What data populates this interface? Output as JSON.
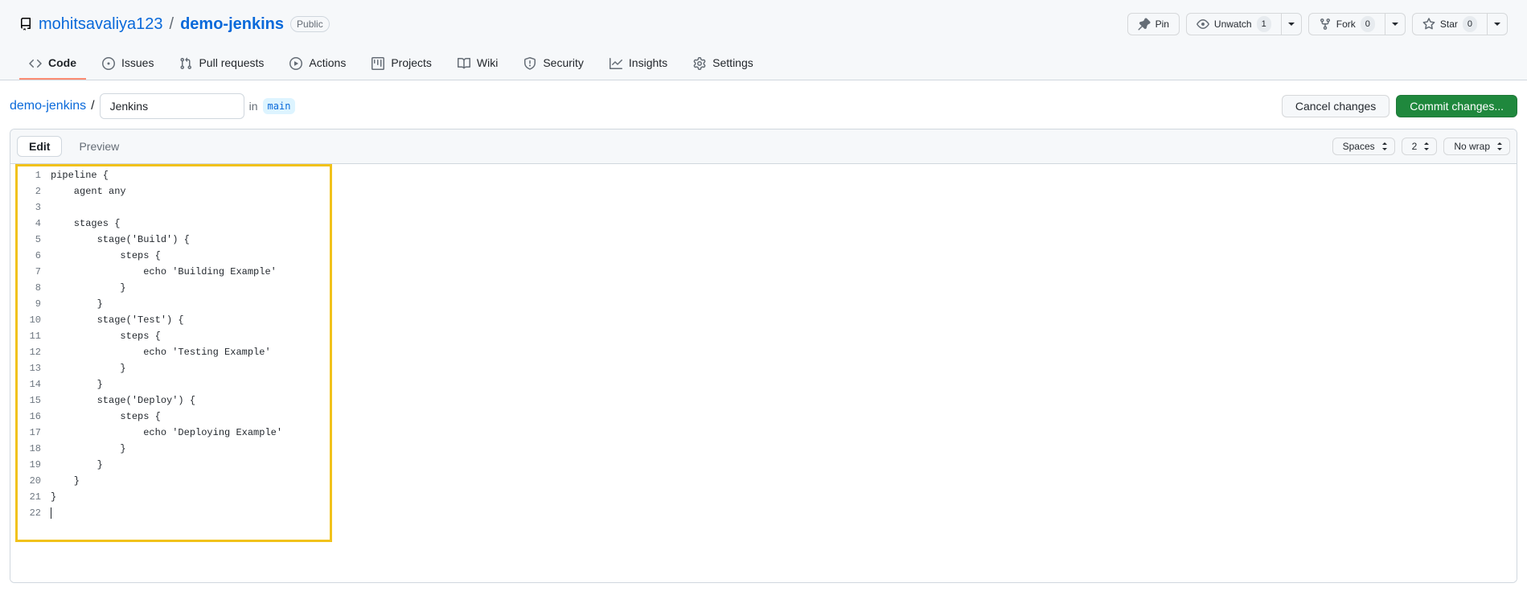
{
  "repo": {
    "owner": "mohitsavaliya123",
    "name": "demo-jenkins",
    "separator": "/",
    "visibility": "Public"
  },
  "actions": {
    "pin": "Pin",
    "unwatch": "Unwatch",
    "unwatch_count": "1",
    "fork": "Fork",
    "fork_count": "0",
    "star": "Star",
    "star_count": "0"
  },
  "nav": {
    "code": "Code",
    "issues": "Issues",
    "pull_requests": "Pull requests",
    "actions": "Actions",
    "projects": "Projects",
    "wiki": "Wiki",
    "security": "Security",
    "insights": "Insights",
    "settings": "Settings"
  },
  "path": {
    "repo_link": "demo-jenkins",
    "separator": "/",
    "filename_value": "Jenkins",
    "in_text": "in",
    "branch": "main"
  },
  "buttons": {
    "cancel": "Cancel changes",
    "commit": "Commit changes..."
  },
  "editor": {
    "tabs": {
      "edit": "Edit",
      "preview": "Preview"
    },
    "controls": {
      "indent_mode": "Spaces",
      "indent_size": "2",
      "wrap": "No wrap"
    }
  },
  "code_lines": [
    "pipeline {",
    "    agent any",
    "",
    "    stages {",
    "        stage('Build') {",
    "            steps {",
    "                echo 'Building Example'",
    "            }",
    "        }",
    "        stage('Test') {",
    "            steps {",
    "                echo 'Testing Example'",
    "            }",
    "        }",
    "        stage('Deploy') {",
    "            steps {",
    "                echo 'Deploying Example'",
    "            }",
    "        }",
    "    }",
    "}",
    ""
  ]
}
